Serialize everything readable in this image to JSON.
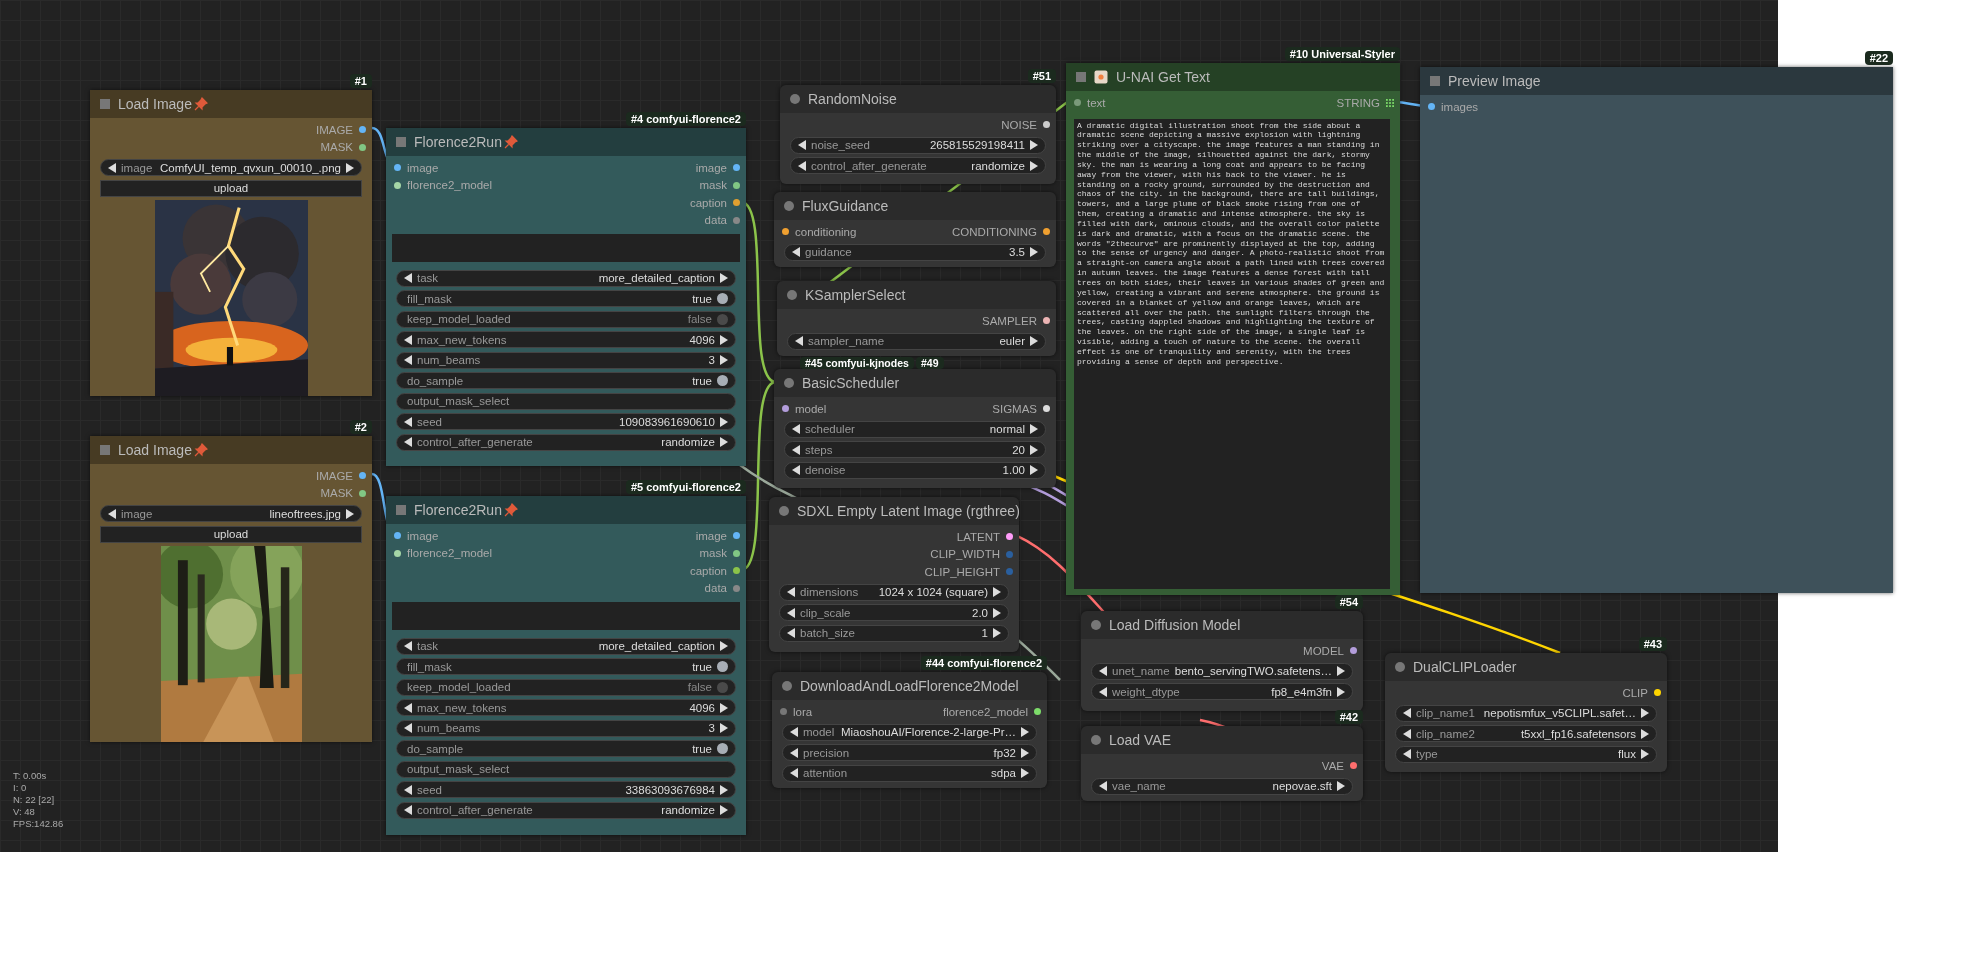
{
  "nodes": [
    {
      "title": "Load Image",
      "badge": "#1",
      "color": "#665533",
      "pinned": true,
      "outputs": [
        {
          "label": "IMAGE",
          "color": "#64b5f6"
        },
        {
          "label": "MASK",
          "color": "#81c784"
        }
      ],
      "widgets": [
        {
          "kind": "combo",
          "name": "image",
          "value": "ComfyUI_temp_qvxun_00010_.png"
        },
        {
          "kind": "button",
          "label": "upload"
        },
        {
          "kind": "picture"
        }
      ]
    },
    {
      "title": "Florence2Run",
      "badge": "#4 comfyui-florence2",
      "color": "#335a5b",
      "pinned": true,
      "inputs": [
        {
          "label": "image",
          "color": "#64b5f6"
        },
        {
          "label": "florence2_model",
          "color": "#a5d6a7"
        }
      ],
      "outputs": [
        {
          "label": "image",
          "color": "#64b5f6"
        },
        {
          "label": "mask",
          "color": "#81c784"
        },
        {
          "label": "caption",
          "color": "#e0a030"
        },
        {
          "label": "data",
          "color": "#888888"
        }
      ],
      "widgets": [
        {
          "kind": "textarea"
        },
        {
          "kind": "combo",
          "name": "task",
          "value": "more_detailed_caption"
        },
        {
          "kind": "toggle",
          "name": "fill_mask",
          "value": "true",
          "on": true
        },
        {
          "kind": "toggle",
          "name": "keep_model_loaded",
          "value": "false",
          "on": false
        },
        {
          "kind": "combo",
          "name": "max_new_tokens",
          "value": "4096"
        },
        {
          "kind": "combo",
          "name": "num_beams",
          "value": "3"
        },
        {
          "kind": "toggle",
          "name": "do_sample",
          "value": "true",
          "on": true
        },
        {
          "kind": "text",
          "name": "output_mask_select"
        },
        {
          "kind": "combo",
          "name": "seed",
          "value": "109083961690610"
        },
        {
          "kind": "combo",
          "name": "control_after_generate",
          "value": "randomize"
        }
      ]
    },
    {
      "title": "Load Image",
      "badge": "#2",
      "color": "#665533",
      "pinned": true,
      "outputs": [
        {
          "label": "IMAGE",
          "color": "#64b5f6"
        },
        {
          "label": "MASK",
          "color": "#81c784"
        }
      ],
      "widgets": [
        {
          "kind": "combo",
          "name": "image",
          "value": "lineoftrees.jpg"
        },
        {
          "kind": "button",
          "label": "upload"
        },
        {
          "kind": "picture"
        }
      ]
    },
    {
      "title": "Florence2Run",
      "badge": "#5 comfyui-florence2",
      "color": "#335a5b",
      "pinned": true,
      "inputs": [
        {
          "label": "image",
          "color": "#64b5f6"
        },
        {
          "label": "florence2_model",
          "color": "#a5d6a7"
        }
      ],
      "outputs": [
        {
          "label": "image",
          "color": "#64b5f6"
        },
        {
          "label": "mask",
          "color": "#81c784"
        },
        {
          "label": "caption",
          "color": "#8bc34a"
        },
        {
          "label": "data",
          "color": "#888888"
        }
      ],
      "widgets": [
        {
          "kind": "textarea"
        },
        {
          "kind": "combo",
          "name": "task",
          "value": "more_detailed_caption"
        },
        {
          "kind": "toggle",
          "name": "fill_mask",
          "value": "true",
          "on": true
        },
        {
          "kind": "toggle",
          "name": "keep_model_loaded",
          "value": "false",
          "on": false
        },
        {
          "kind": "combo",
          "name": "max_new_tokens",
          "value": "4096"
        },
        {
          "kind": "combo",
          "name": "num_beams",
          "value": "3"
        },
        {
          "kind": "toggle",
          "name": "do_sample",
          "value": "true",
          "on": true
        },
        {
          "kind": "text",
          "name": "output_mask_select"
        },
        {
          "kind": "combo",
          "name": "seed",
          "value": "33863093676984"
        },
        {
          "kind": "combo",
          "name": "control_after_generate",
          "value": "randomize"
        }
      ]
    },
    {
      "title": "RandomNoise",
      "badge": "#51",
      "outputs": [
        {
          "label": "NOISE",
          "color": "#cccccc"
        }
      ],
      "widgets": [
        {
          "kind": "combo",
          "name": "noise_seed",
          "value": "265815529198411"
        },
        {
          "kind": "combo",
          "name": "control_after_generate",
          "value": "randomize"
        }
      ]
    },
    {
      "title": "FluxGuidance",
      "inputs": [
        {
          "label": "conditioning",
          "color": "#f0a030"
        }
      ],
      "outputs": [
        {
          "label": "CONDITIONING",
          "color": "#f0a030"
        }
      ],
      "widgets": [
        {
          "kind": "combo",
          "name": "guidance",
          "value": "3.5"
        }
      ]
    },
    {
      "title": "KSamplerSelect",
      "outputs": [
        {
          "label": "SAMPLER",
          "color": "#ecb4b4"
        }
      ],
      "widgets": [
        {
          "kind": "combo",
          "name": "sampler_name",
          "value": "euler"
        }
      ]
    },
    {
      "title": "BasicScheduler",
      "inputs": [
        {
          "label": "model",
          "color": "#b39ddb"
        }
      ],
      "outputs": [
        {
          "label": "SIGMAS",
          "color": "#dddddd"
        }
      ],
      "widgets": [
        {
          "kind": "combo",
          "name": "scheduler",
          "value": "normal"
        },
        {
          "kind": "combo",
          "name": "steps",
          "value": "20"
        },
        {
          "kind": "combo",
          "name": "denoise",
          "value": "1.00"
        }
      ]
    },
    {
      "title": "SDXL Empty Latent Image (rgthree)",
      "outputs": [
        {
          "label": "LATENT",
          "color": "#ff9cf9"
        },
        {
          "label": "CLIP_WIDTH",
          "color": "#2a5f9e"
        },
        {
          "label": "CLIP_HEIGHT",
          "color": "#2a5f9e"
        }
      ],
      "widgets": [
        {
          "kind": "combo",
          "name": "dimensions",
          "value": "1024 x 1024  (square)"
        },
        {
          "kind": "combo",
          "name": "clip_scale",
          "value": "2.0"
        },
        {
          "kind": "combo",
          "name": "batch_size",
          "value": "1"
        }
      ]
    },
    {
      "title": "DownloadAndLoadFlorence2Model",
      "badge": "#44 comfyui-florence2",
      "inputs": [
        {
          "label": "lora",
          "color": "#777777"
        }
      ],
      "outputs": [
        {
          "label": "florence2_model",
          "color": "#7ddc6a"
        }
      ],
      "widgets": [
        {
          "kind": "combo",
          "name": "model",
          "value": "MiaoshouAI/Florence-2-large-Pr…"
        },
        {
          "kind": "combo",
          "name": "precision",
          "value": "fp32"
        },
        {
          "kind": "combo",
          "name": "attention",
          "value": "sdpa"
        }
      ]
    },
    {
      "title": "U-NAI Get Text",
      "badge": "#10 Universal-Styler",
      "color": "#355e35",
      "has_icon": true,
      "inputs": [
        {
          "label": "text",
          "color": "#7a9a7a"
        }
      ],
      "outputs": [
        {
          "label": "STRING",
          "color": "#7ddc6a",
          "grid": true
        }
      ],
      "widgets": [
        {
          "kind": "textarea",
          "text": "A dramatic digital illustration shoot from the side about a dramatic scene depicting a massive explosion with lightning striking over a cityscape. the image features a man standing in the middle of the image, silhouetted against the dark, stormy sky. the man is wearing a long coat and appears to be facing away from the viewer, with his back to the viewer. he is standing on a rocky ground, surrounded by the destruction and chaos of the city. in the background, there are tall buildings, towers, and a large plume of black smoke rising from one of them, creating a dramatic and intense atmosphere. the sky is filled with dark, ominous clouds, and the overall color palette is dark and dramatic, with a focus on the dramatic scene. the words \"2thecurve\" are prominently displayed at the top, adding to the sense of urgency and danger. A photo-realistic shoot from a straight-on camera angle about a path lined with trees covered in autumn leaves. the image features a dense forest with tall trees on both sides, their leaves in various shades of green and yellow, creating a vibrant and serene atmosphere. the ground is covered in a blanket of yellow and orange leaves, which are scattered all over the path. the sunlight filters through the trees, casting dappled shadows and highlighting the texture of the leaves. on the right side of the image, a single leaf is visible, adding a touch of nature to the scene. the overall effect is one of tranquility and serenity, with the trees providing a sense of depth and perspective."
        }
      ]
    },
    {
      "title": "Preview Image",
      "badge": "#22",
      "color": "#3e515a",
      "inputs": [
        {
          "label": "images",
          "color": "#64b5f6"
        }
      ]
    },
    {
      "title": "Load Diffusion Model",
      "badge": "#54",
      "outputs": [
        {
          "label": "MODEL",
          "color": "#b39ddb"
        }
      ],
      "widgets": [
        {
          "kind": "combo",
          "name": "unet_name",
          "value": "bento_servingTWO.safetens…"
        },
        {
          "kind": "combo",
          "name": "weight_dtype",
          "value": "fp8_e4m3fn"
        }
      ]
    },
    {
      "title": "Load VAE",
      "badge": "#42",
      "outputs": [
        {
          "label": "VAE",
          "color": "#ff6e6e"
        }
      ],
      "widgets": [
        {
          "kind": "combo",
          "name": "vae_name",
          "value": "nepovae.sft"
        }
      ]
    },
    {
      "title": "DualCLIPLoader",
      "badge": "#43",
      "outputs": [
        {
          "label": "CLIP",
          "color": "#ffd500"
        }
      ],
      "widgets": [
        {
          "kind": "combo",
          "name": "clip_name1",
          "value": "nepotismfux_v5CLIPL.safet…"
        },
        {
          "kind": "combo",
          "name": "clip_name2",
          "value": "t5xxl_fp16.safetensors"
        },
        {
          "kind": "combo",
          "name": "type",
          "value": "flux"
        }
      ]
    }
  ],
  "floating_badges": [
    "#45 comfyui-kjnodes",
    "#49"
  ],
  "stats": [
    "T: 0.00s",
    "I: 0",
    "N: 22 [22]",
    "V: 48",
    "FPS:142.86"
  ]
}
